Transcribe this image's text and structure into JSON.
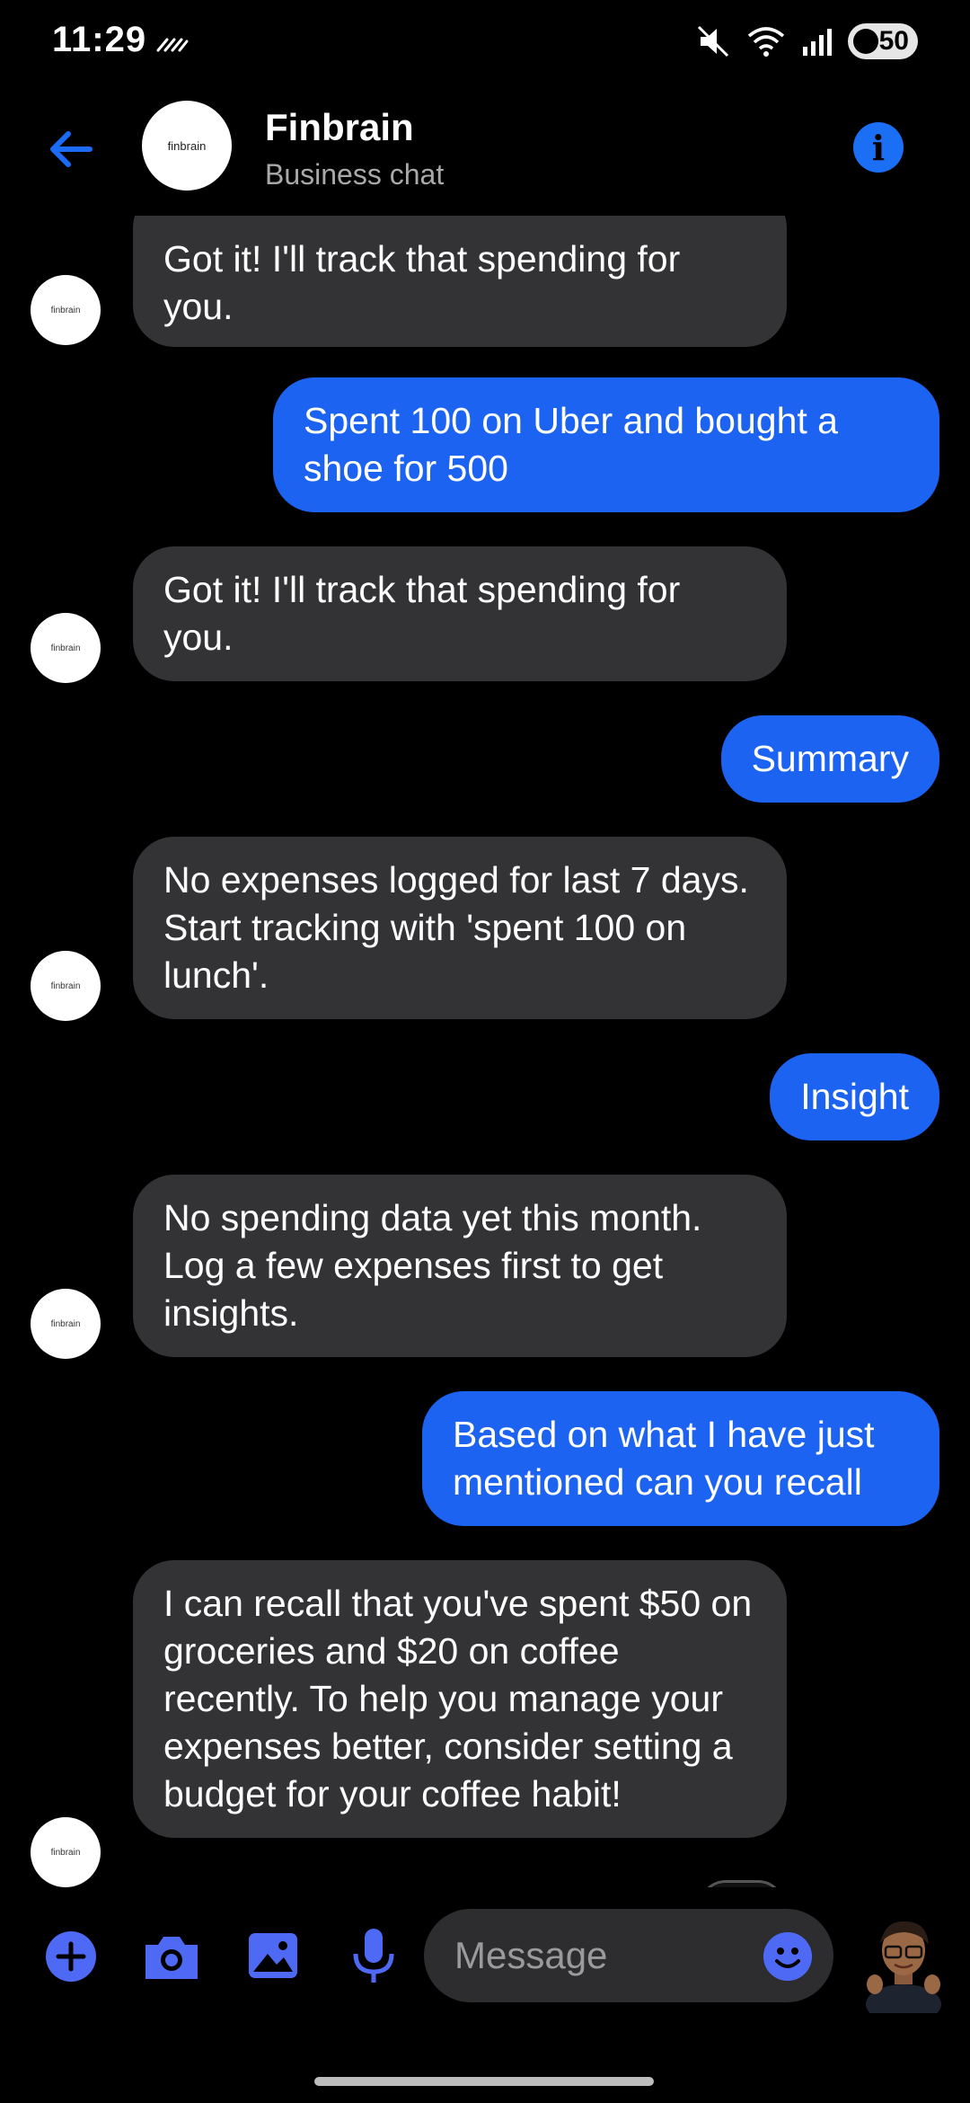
{
  "status_bar": {
    "time": "11:29",
    "battery": "50"
  },
  "header": {
    "name": "Finbrain",
    "subtitle": "Business chat",
    "avatar_text": "finbrain"
  },
  "bot_avatar_text": "finbrain",
  "messages": [
    {
      "from": "bot",
      "text": "Got it! I'll track that spending for you."
    },
    {
      "from": "user",
      "text": "Spent 100 on Uber and bought a shoe for 500"
    },
    {
      "from": "bot",
      "text": "Got it! I'll track that spending for you."
    },
    {
      "from": "user",
      "text": "Summary"
    },
    {
      "from": "bot",
      "text": "No expenses logged for last 7 days. Start tracking with 'spent 100 on lunch'."
    },
    {
      "from": "user",
      "text": "Insight"
    },
    {
      "from": "bot",
      "text": "No spending data yet this month. Log a few expenses first to get insights."
    },
    {
      "from": "user",
      "text": "Based on what I have just mentioned can you recall"
    },
    {
      "from": "bot",
      "text": "I can recall that you've spent $50 on groceries and $20 on coffee recently. To help you manage your expenses better, consider setting a budget for your coffee habit!"
    }
  ],
  "composer": {
    "placeholder": "Message"
  },
  "colors": {
    "accent": "#1c63f2",
    "bot_bubble": "#333335",
    "background": "#000000"
  }
}
